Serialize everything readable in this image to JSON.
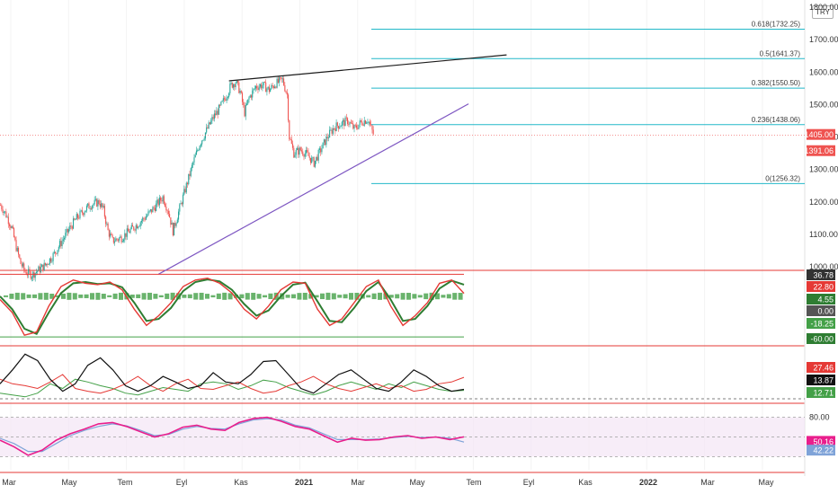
{
  "currency": "TRY",
  "colors": {
    "up": "#26a69a",
    "down": "#ef5350",
    "fib": "#22b8c9",
    "resistance": "#1b1b1b",
    "support": "#7e57c2",
    "panel_border": "#e53935",
    "stoch_k": "#e53935",
    "stoch_d": "#2e7d32",
    "rsi": "#e91e8c",
    "rsi_ma": "#7fa3d8",
    "adx": "#111111",
    "di_minus": "#e53935",
    "di_plus": "#43a047"
  },
  "chart_data": [
    {
      "type": "candlestick",
      "panel": "price",
      "x_ticks": [
        "Mar",
        "May",
        "Tem",
        "Eyl",
        "Kas",
        "2021",
        "Mar",
        "May",
        "Tem",
        "Eyl",
        "Kas",
        "2022",
        "Mar",
        "May"
      ],
      "y_ticks": [
        "1800.00",
        "1700.00",
        "1600.00",
        "1500.00",
        "1400.00",
        "1300.00",
        "1200.00",
        "1100.00",
        "1000.00"
      ],
      "ylim": [
        970,
        1800
      ],
      "last_price": "1405.00",
      "prev_label": "1391.06",
      "approx_close_path": [
        [
          0,
          1190
        ],
        [
          5,
          1160
        ],
        [
          10,
          1120
        ],
        [
          14,
          1060
        ],
        [
          18,
          1010
        ],
        [
          22,
          985
        ],
        [
          28,
          975
        ],
        [
          34,
          990
        ],
        [
          40,
          1005
        ],
        [
          48,
          1040
        ],
        [
          55,
          1080
        ],
        [
          62,
          1120
        ],
        [
          68,
          1150
        ],
        [
          75,
          1175
        ],
        [
          80,
          1190
        ],
        [
          88,
          1200
        ],
        [
          92,
          1175
        ],
        [
          96,
          1110
        ],
        [
          100,
          1080
        ],
        [
          108,
          1090
        ],
        [
          115,
          1110
        ],
        [
          122,
          1130
        ],
        [
          130,
          1155
        ],
        [
          138,
          1185
        ],
        [
          145,
          1215
        ],
        [
          150,
          1170
        ],
        [
          154,
          1110
        ],
        [
          160,
          1180
        ],
        [
          166,
          1250
        ],
        [
          172,
          1320
        ],
        [
          178,
          1380
        ],
        [
          184,
          1420
        ],
        [
          190,
          1460
        ],
        [
          196,
          1490
        ],
        [
          202,
          1530
        ],
        [
          206,
          1560
        ],
        [
          210,
          1570
        ],
        [
          214,
          1540
        ],
        [
          218,
          1475
        ],
        [
          222,
          1520
        ],
        [
          228,
          1555
        ],
        [
          234,
          1560
        ],
        [
          240,
          1545
        ],
        [
          246,
          1565
        ],
        [
          252,
          1575
        ],
        [
          256,
          1530
        ],
        [
          258,
          1400
        ],
        [
          262,
          1350
        ],
        [
          268,
          1360
        ],
        [
          274,
          1345
        ],
        [
          280,
          1320
        ],
        [
          286,
          1360
        ],
        [
          292,
          1400
        ],
        [
          298,
          1430
        ],
        [
          304,
          1440
        ],
        [
          310,
          1450
        ],
        [
          316,
          1425
        ],
        [
          322,
          1445
        ],
        [
          328,
          1455
        ],
        [
          334,
          1400
        ]
      ],
      "fib_levels": [
        {
          "label": "0.618(1732.25)",
          "value": 1732.25
        },
        {
          "label": "0.5(1641.37)",
          "value": 1641.37
        },
        {
          "label": "0.382(1550.50)",
          "value": 1550.5
        },
        {
          "label": "0.236(1438.06)",
          "value": 1438.06
        },
        {
          "label": "0(1256.32)",
          "value": 1256.32
        }
      ],
      "trendlines": [
        {
          "name": "resistance",
          "points": [
            [
              166,
              1573
            ],
            [
              414,
              1653
            ]
          ]
        },
        {
          "name": "support",
          "points": [
            [
              103,
              977
            ],
            [
              380,
              1502
            ]
          ]
        }
      ]
    },
    {
      "type": "line",
      "panel": "stochastic",
      "ylim": [
        -75,
        40
      ],
      "badges": [
        "36.78",
        "22.80",
        "4.55",
        "0.00",
        "-18.25",
        "-60.00"
      ],
      "series": [
        {
          "name": "K",
          "values": [
            -5,
            -25,
            -60,
            -55,
            -15,
            15,
            25,
            20,
            18,
            22,
            10,
            -20,
            -45,
            -30,
            -10,
            15,
            25,
            28,
            20,
            5,
            -20,
            -35,
            -15,
            10,
            22,
            20,
            -20,
            -45,
            -35,
            -10,
            15,
            25,
            -15,
            -45,
            -30,
            -10,
            20,
            25,
            4.5
          ]
        },
        {
          "name": "D",
          "values": [
            0,
            -20,
            -50,
            -58,
            -25,
            5,
            20,
            22,
            19,
            20,
            14,
            -10,
            -38,
            -35,
            -18,
            8,
            22,
            26,
            23,
            10,
            -12,
            -30,
            -22,
            0,
            18,
            21,
            -8,
            -38,
            -40,
            -18,
            8,
            22,
            -5,
            -38,
            -35,
            -15,
            12,
            24,
            18
          ]
        }
      ],
      "levels": [
        {
          "label": "22.80",
          "value": 22.8
        },
        {
          "label": "-60.00",
          "value": -60.0
        }
      ]
    },
    {
      "type": "line",
      "panel": "adx",
      "ylim": [
        0,
        60
      ],
      "badges": [
        "27.46",
        "13.87",
        "12.71"
      ],
      "series": [
        {
          "name": "ADX",
          "values": [
            20,
            35,
            52,
            45,
            25,
            12,
            20,
            40,
            48,
            35,
            18,
            12,
            18,
            28,
            22,
            15,
            18,
            32,
            22,
            20,
            30,
            44,
            45,
            30,
            15,
            10,
            20,
            30,
            35,
            25,
            15,
            12,
            22,
            35,
            28,
            18,
            12,
            14
          ]
        },
        {
          "name": "-DI",
          "values": [
            25,
            20,
            18,
            15,
            22,
            30,
            15,
            12,
            10,
            14,
            20,
            28,
            18,
            12,
            20,
            25,
            15,
            14,
            18,
            22,
            15,
            10,
            12,
            18,
            22,
            28,
            20,
            15,
            12,
            16,
            20,
            15,
            18,
            12,
            14,
            20,
            22,
            27
          ]
        },
        {
          "name": "+DI",
          "values": [
            10,
            8,
            6,
            10,
            20,
            15,
            25,
            22,
            18,
            15,
            10,
            8,
            12,
            16,
            14,
            12,
            20,
            22,
            20,
            14,
            18,
            24,
            22,
            16,
            12,
            8,
            12,
            18,
            22,
            18,
            14,
            20,
            16,
            22,
            18,
            14,
            12,
            13
          ]
        }
      ]
    },
    {
      "type": "line",
      "panel": "rsi",
      "ylim": [
        0,
        100
      ],
      "badges": [
        "80.00",
        "50.16",
        "42.22"
      ],
      "series": [
        {
          "name": "RSI",
          "values": [
            45,
            35,
            22,
            30,
            45,
            55,
            62,
            70,
            72,
            66,
            58,
            50,
            55,
            65,
            68,
            62,
            60,
            72,
            78,
            80,
            74,
            66,
            62,
            52,
            42,
            48,
            45,
            46,
            50,
            52,
            48,
            50,
            46,
            50.16
          ]
        },
        {
          "name": "MA",
          "values": [
            48,
            40,
            28,
            28,
            40,
            52,
            60,
            66,
            70,
            67,
            60,
            52,
            54,
            62,
            66,
            63,
            62,
            70,
            76,
            78,
            76,
            68,
            64,
            55,
            46,
            46,
            46,
            47,
            49,
            51,
            49,
            50,
            48,
            42.22
          ]
        }
      ],
      "levels": [
        80,
        50,
        20
      ]
    }
  ]
}
